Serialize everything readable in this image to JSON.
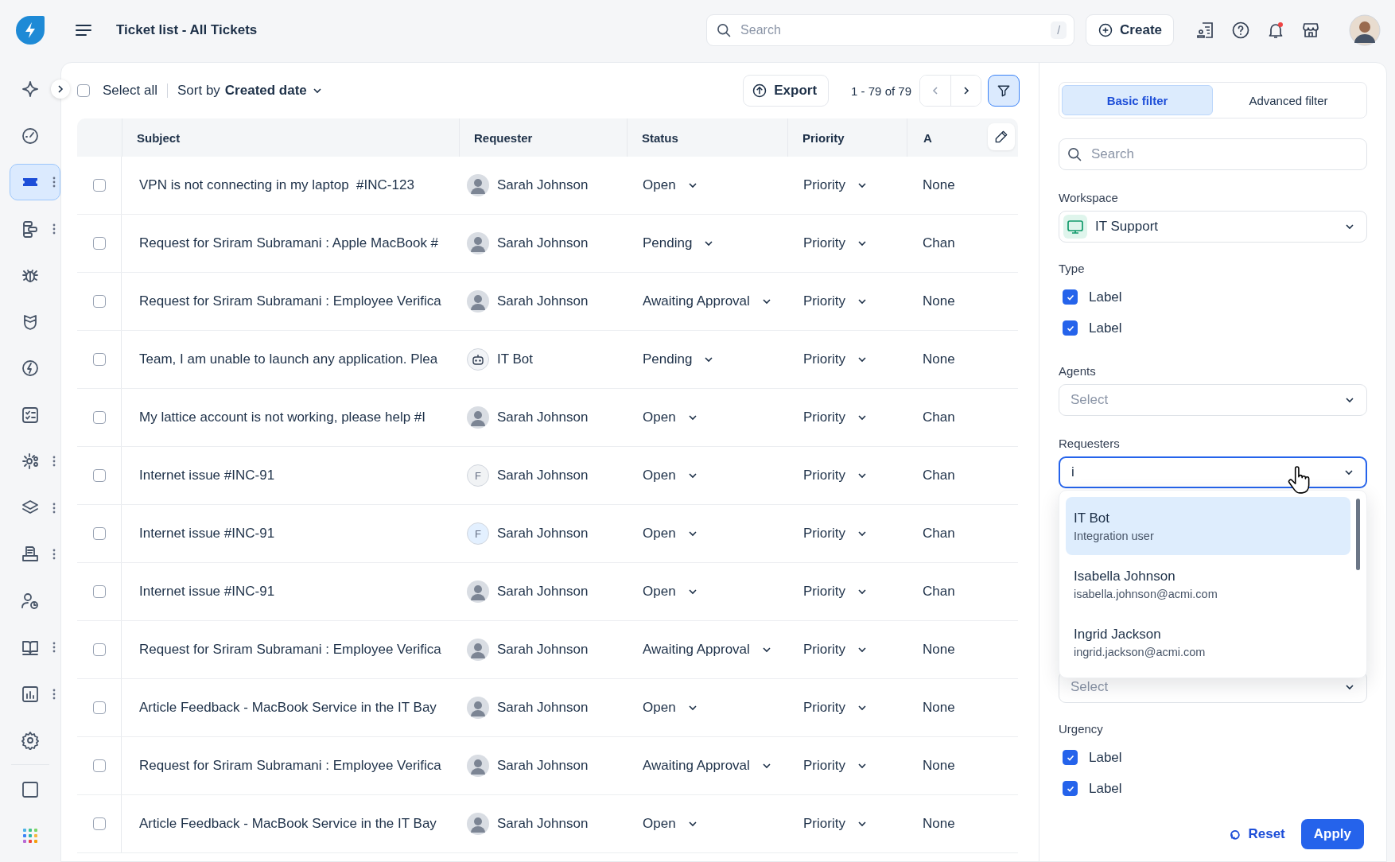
{
  "app": {
    "title": "Ticket list - All Tickets"
  },
  "search": {
    "placeholder": "Search",
    "shortcut": "/"
  },
  "create_button": {
    "label": "Create"
  },
  "notifications": {
    "unread": true
  },
  "sidebar": {
    "items": [
      {
        "selected": false,
        "menu": false
      },
      {
        "selected": false,
        "menu": false
      },
      {
        "selected": true,
        "menu": true
      },
      {
        "selected": false,
        "menu": true
      },
      {
        "selected": false,
        "menu": false
      },
      {
        "selected": false,
        "menu": false
      },
      {
        "selected": false,
        "menu": false
      },
      {
        "selected": false,
        "menu": false
      },
      {
        "selected": false,
        "menu": true
      },
      {
        "selected": false,
        "menu": true
      },
      {
        "selected": false,
        "menu": true
      },
      {
        "selected": false,
        "menu": false
      },
      {
        "selected": false,
        "menu": true
      },
      {
        "selected": false,
        "menu": true
      },
      {
        "selected": false,
        "menu": false
      }
    ],
    "bottom_items": [
      {
        "selected": false
      },
      {
        "selected": false
      }
    ]
  },
  "toolbar": {
    "select_all": {
      "label": "Select all",
      "checked": false
    },
    "sort": {
      "prefix": "Sort by",
      "value": "Created date"
    },
    "export": {
      "label": "Export"
    },
    "pagination": "1 - 79 of 79",
    "filter": {
      "selected": true
    }
  },
  "table": {
    "columns": [
      "Subject",
      "Requester",
      "Status",
      "Priority",
      "A"
    ],
    "rows": [
      {
        "checked": false,
        "subject": "VPN is not connecting in my laptop  #INC-123",
        "requester": "Sarah Johnson",
        "avatar": {
          "kind": "photo"
        },
        "status": "Open",
        "priority": "Priority",
        "column_5": "None"
      },
      {
        "checked": false,
        "subject": "Request for Sriram Subramani : Apple MacBook #",
        "requester": "Sarah Johnson",
        "avatar": {
          "kind": "photo"
        },
        "status": "Pending",
        "priority": "Priority",
        "column_5": "Chan"
      },
      {
        "checked": false,
        "subject": "Request for Sriram Subramani : Employee Verifica",
        "requester": "Sarah Johnson",
        "avatar": {
          "kind": "photo"
        },
        "status": "Awaiting Approval",
        "priority": "Priority",
        "column_5": "None"
      },
      {
        "checked": false,
        "subject": "Team, I am unable to launch any application. Plea",
        "requester": "IT Bot",
        "avatar": {
          "kind": "bot"
        },
        "status": "Pending",
        "priority": "Priority",
        "column_5": "None"
      },
      {
        "checked": false,
        "subject": "My lattice account is not working, please help #I",
        "requester": "Sarah Johnson",
        "avatar": {
          "kind": "photo"
        },
        "status": "Open",
        "priority": "Priority",
        "column_5": "Chan"
      },
      {
        "checked": false,
        "subject": "Internet issue #INC-91",
        "requester": "Sarah Johnson",
        "avatar": {
          "kind": "initial",
          "text": "F",
          "color": "#f1f3f5"
        },
        "status": "Open",
        "priority": "Priority",
        "column_5": "Chan"
      },
      {
        "checked": false,
        "subject": "Internet issue #INC-91",
        "requester": "Sarah Johnson",
        "avatar": {
          "kind": "initial",
          "text": "F",
          "color": "#e3f0ff"
        },
        "status": "Open",
        "priority": "Priority",
        "column_5": "Chan"
      },
      {
        "checked": false,
        "subject": "Internet issue #INC-91",
        "requester": "Sarah Johnson",
        "avatar": {
          "kind": "photo"
        },
        "status": "Open",
        "priority": "Priority",
        "column_5": "Chan"
      },
      {
        "checked": false,
        "subject": "Request for Sriram Subramani : Employee Verifica",
        "requester": "Sarah Johnson",
        "avatar": {
          "kind": "photo"
        },
        "status": "Awaiting Approval",
        "priority": "Priority",
        "column_5": "None"
      },
      {
        "checked": false,
        "subject": "Article Feedback - MacBook Service in the IT Bay",
        "requester": "Sarah Johnson",
        "avatar": {
          "kind": "photo"
        },
        "status": "Open",
        "priority": "Priority",
        "column_5": "None"
      },
      {
        "checked": false,
        "subject": "Request for Sriram Subramani : Employee Verifica",
        "requester": "Sarah Johnson",
        "avatar": {
          "kind": "photo"
        },
        "status": "Awaiting Approval",
        "priority": "Priority",
        "column_5": "None"
      },
      {
        "checked": false,
        "subject": "Article Feedback - MacBook Service in the IT Bay",
        "requester": "Sarah Johnson",
        "avatar": {
          "kind": "photo"
        },
        "status": "Open",
        "priority": "Priority",
        "column_5": "None"
      }
    ]
  },
  "filter_panel": {
    "tabs": [
      {
        "label": "Basic filter",
        "selected": true
      },
      {
        "label": "Advanced filter",
        "selected": false
      }
    ],
    "search": {
      "placeholder": "Search"
    },
    "fields": [
      {
        "kind": "select",
        "label": "Workspace",
        "value": "IT Support"
      },
      {
        "kind": "checks",
        "label": "Type",
        "options": [
          {
            "label": "Label",
            "checked": true
          },
          {
            "label": "Label",
            "checked": true
          }
        ]
      },
      {
        "kind": "select",
        "label": "Agents",
        "placeholder": "Select"
      },
      {
        "kind": "combobox",
        "label": "Requesters",
        "value": "i",
        "expanded": true,
        "options": [
          {
            "name": "IT Bot",
            "detail": "Integration user",
            "selected": true
          },
          {
            "name": "Isabella Johnson",
            "detail": "isabella.johnson@acmi.com",
            "selected": false
          },
          {
            "name": "Ingrid Jackson",
            "detail": "ingrid.jackson@acmi.com",
            "selected": false
          }
        ]
      },
      {
        "kind": "select",
        "placeholder": "Select"
      },
      {
        "kind": "checks",
        "label": "Urgency",
        "options": [
          {
            "label": "Label",
            "checked": true
          },
          {
            "label": "Label",
            "checked": true
          }
        ]
      }
    ],
    "reset": {
      "label": "Reset"
    },
    "apply": {
      "label": "Apply"
    }
  }
}
